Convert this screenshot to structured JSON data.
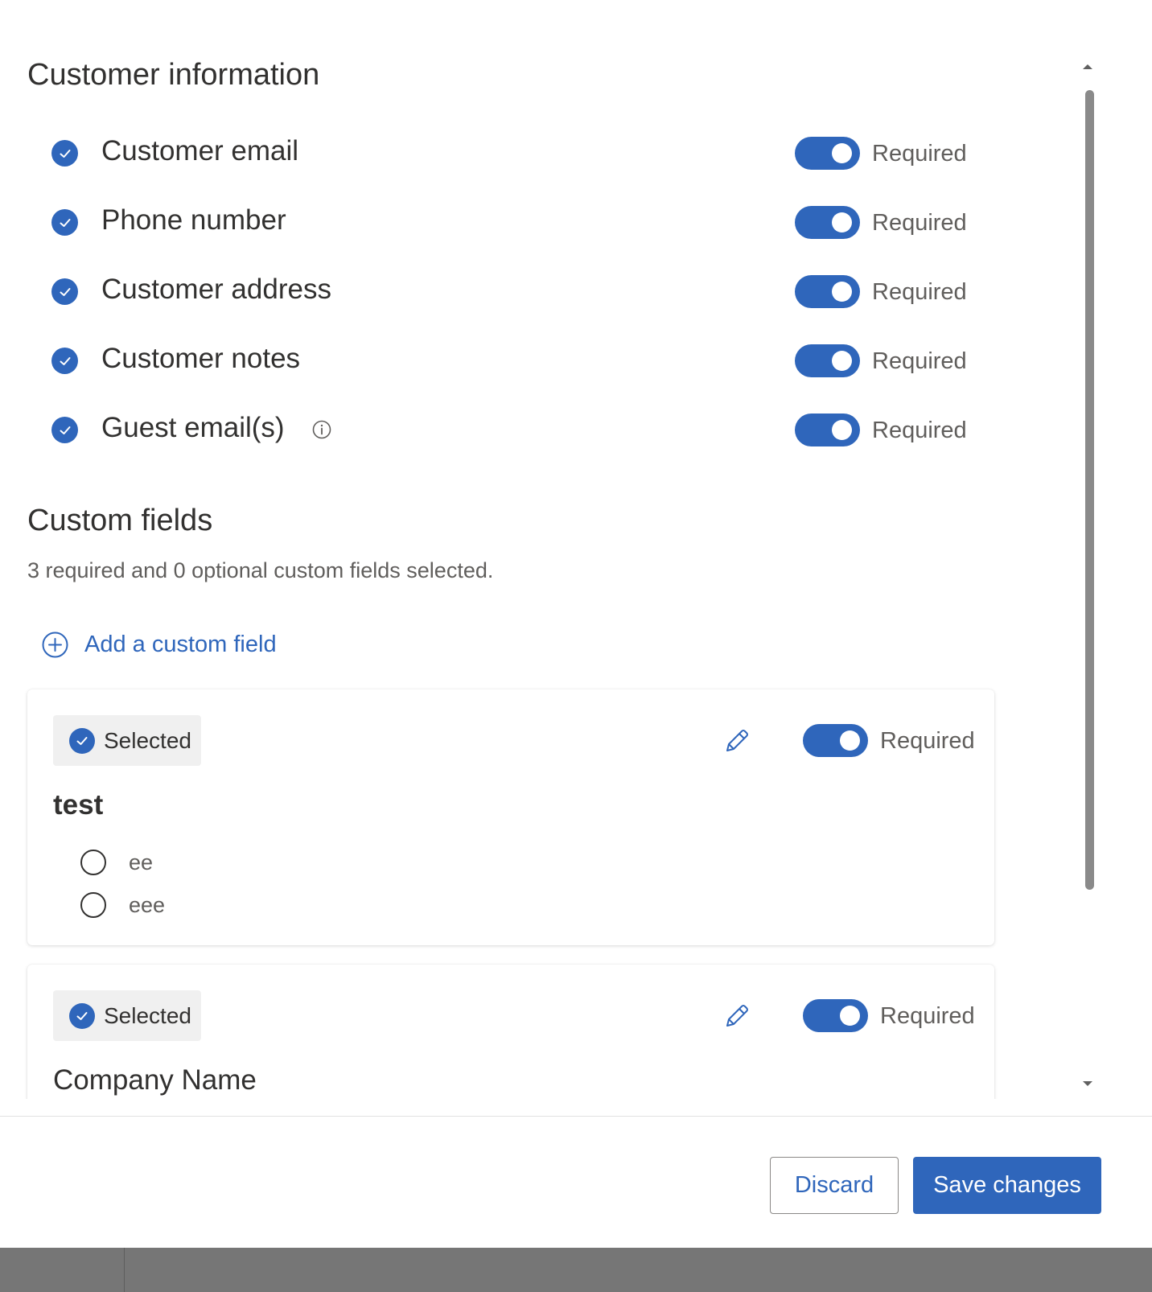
{
  "customer_information": {
    "title": "Customer information",
    "items": [
      {
        "label": "Customer email",
        "checked": true,
        "required": true,
        "required_label": "Required"
      },
      {
        "label": "Phone number",
        "checked": true,
        "required": true,
        "required_label": "Required"
      },
      {
        "label": "Customer address",
        "checked": true,
        "required": true,
        "required_label": "Required"
      },
      {
        "label": "Customer notes",
        "checked": true,
        "required": true,
        "required_label": "Required"
      },
      {
        "label": "Guest email(s)",
        "checked": true,
        "required": true,
        "required_label": "Required",
        "icon": "info-icon"
      }
    ]
  },
  "custom_fields": {
    "title": "Custom fields",
    "summary": "3 required and 0 optional custom fields selected.",
    "add_label": "Add a custom field",
    "fields": [
      {
        "badge_label": "Selected",
        "required_label": "Required",
        "required": true,
        "name": "test",
        "options": [
          "ee",
          "eee"
        ]
      },
      {
        "badge_label": "Selected",
        "required_label": "Required",
        "required": true,
        "name": "Company Name"
      }
    ]
  },
  "footer": {
    "discard_label": "Discard",
    "save_label": "Save changes"
  },
  "colors": {
    "accent": "#2f66bb",
    "text": "#323130",
    "muted": "#605e5c"
  }
}
